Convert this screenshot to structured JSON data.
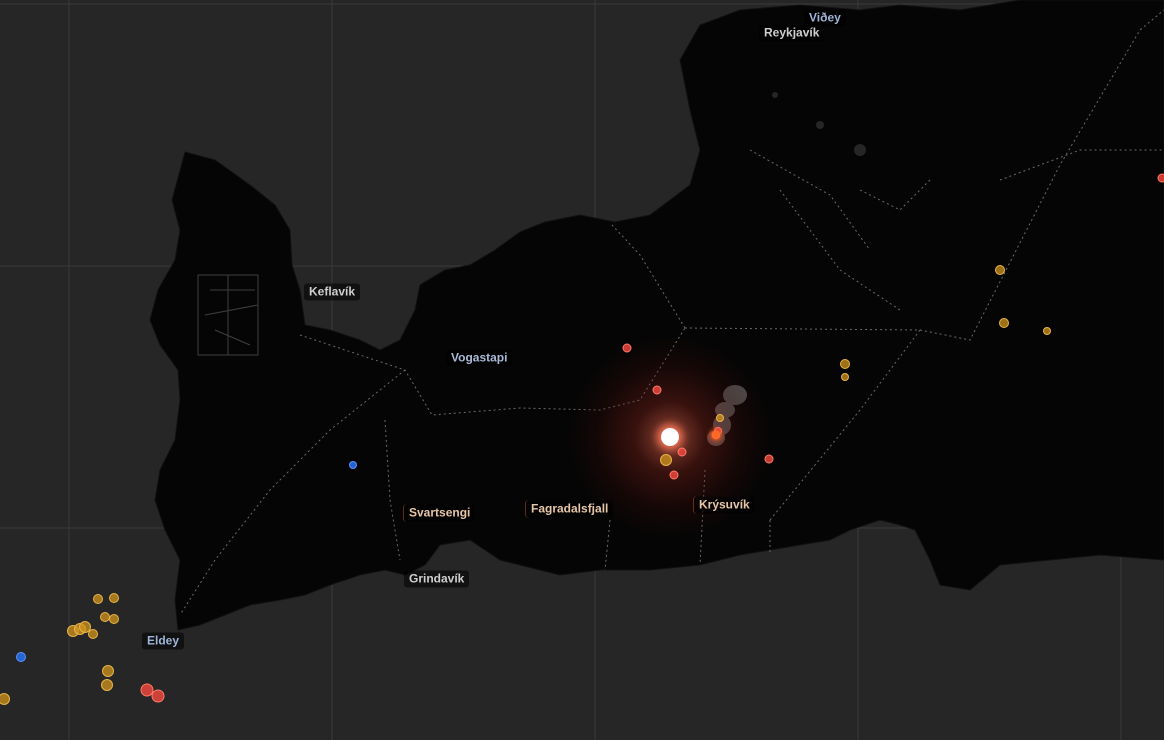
{
  "map": {
    "colors": {
      "sea": "#262626",
      "land": "#050505",
      "border": "#6a6a6a",
      "graticule": "#3a3a3a",
      "plume": "#5a5a5a"
    },
    "labels": [
      {
        "id": "vidhey",
        "text": "Viðey",
        "kind": "islet"
      },
      {
        "id": "reykjavik",
        "text": "Reykjavík",
        "kind": "town"
      },
      {
        "id": "keflavik",
        "text": "Keflavík",
        "kind": "town"
      },
      {
        "id": "vogastapi",
        "text": "Vogastapi",
        "kind": "place"
      },
      {
        "id": "svartsengi",
        "text": "Svartsengi",
        "kind": "volcano"
      },
      {
        "id": "fagradalsfjall",
        "text": "Fagradalsfjall",
        "kind": "volcano"
      },
      {
        "id": "krysuvik",
        "text": "Krýsuvík",
        "kind": "volcano"
      },
      {
        "id": "grindavik",
        "text": "Grindavík",
        "kind": "town"
      },
      {
        "id": "eldey",
        "text": "Eldey",
        "kind": "islet"
      }
    ],
    "icons": {
      "eruption": "eruption-site-icon",
      "quake": "earthquake-marker-icon"
    }
  }
}
